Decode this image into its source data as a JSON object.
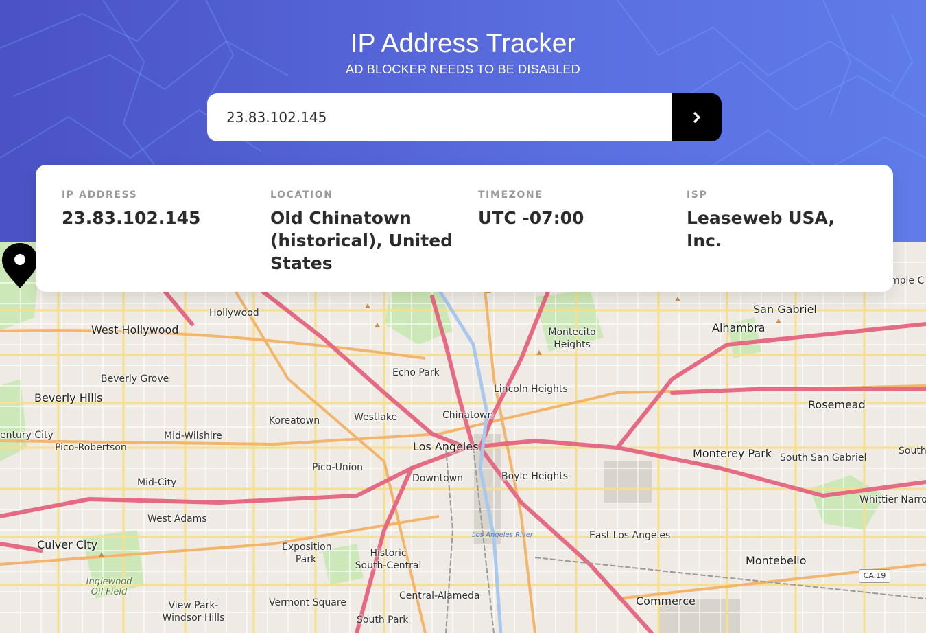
{
  "header": {
    "title": "IP Address Tracker",
    "subtitle": "AD BLOCKER NEEDS TO BE DISABLED"
  },
  "search": {
    "value": "23.83.102.145",
    "button_icon": "chevron-right-icon"
  },
  "info": {
    "ip_label": "IP ADDRESS",
    "ip_value": "23.83.102.145",
    "location_label": "LOCATION",
    "location_value": "Old Chinatown (historical), United States",
    "timezone_label": "TIMEZONE",
    "timezone_value": "UTC -07:00",
    "isp_label": "ISP",
    "isp_value": "Leaseweb USA, Inc."
  },
  "map": {
    "marker_icon": "location-pin-icon",
    "place_labels": [
      "Hollywood",
      "West Hollywood",
      "Beverly Grove",
      "Beverly Hills",
      "Echo Park",
      "Lincoln Heights",
      "Montecito Heights",
      "Alhambra",
      "San Gabriel",
      "Rosemead",
      "Koreatown",
      "Westlake",
      "Chinatown",
      "Los Angeles",
      "Mid-Wilshire",
      "entury City",
      "Pico-Robertson",
      "Pico-Union",
      "Downtown",
      "Boyle Heights",
      "Monterey Park",
      "South San Gabriel",
      "South",
      "Mid-City",
      "West Adams",
      "Culver City",
      "Exposition Park",
      "Historic South-Central",
      "East Los Angeles",
      "Whittier Narrows",
      "Montebello",
      "Inglewood Oil Field",
      "View Park-Windsor Hills",
      "Vermont Square",
      "Central-Alameda",
      "South Park",
      "Commerce",
      "mple C"
    ],
    "river_label": "Los Angeles River",
    "shield_label": "CA 19"
  }
}
